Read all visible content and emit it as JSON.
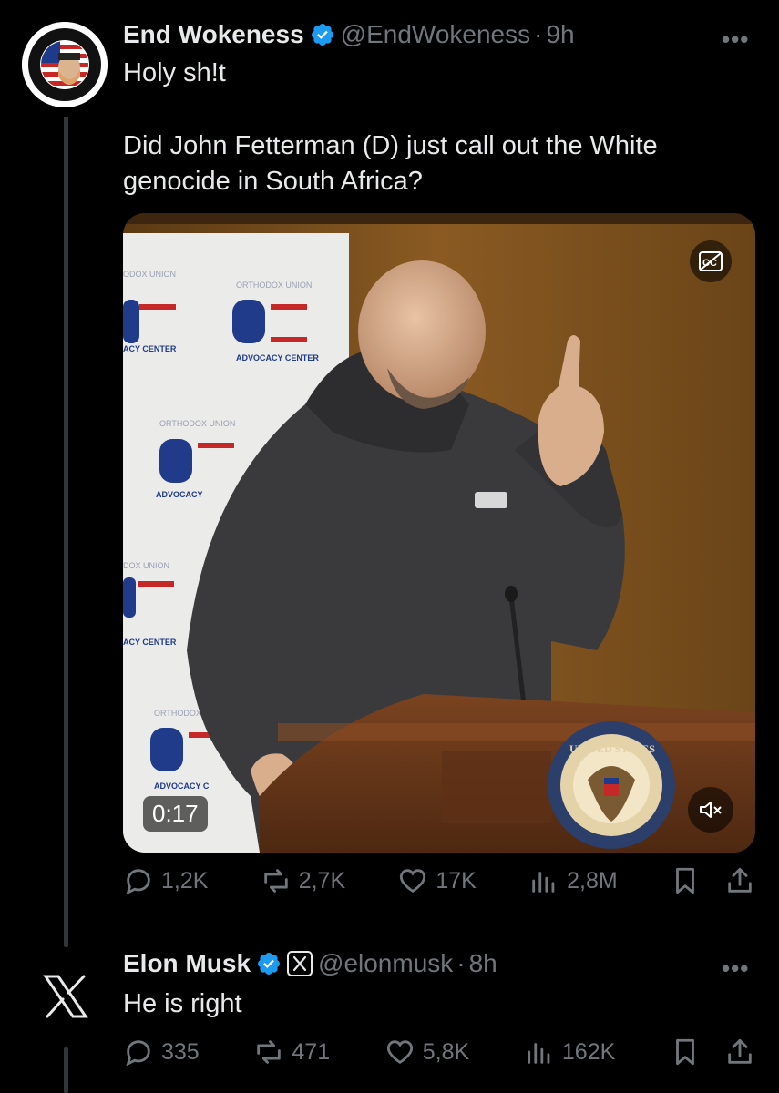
{
  "tweet1": {
    "author": "End Wokeness",
    "handle": "@EndWokeness",
    "separator": "·",
    "time": "9h",
    "more": "•••",
    "text_line1": "Holy sh!t",
    "text_line2": "Did John Fetterman (D) just call out the White",
    "text_line3": "genocide in South Africa?",
    "video": {
      "duration": "0:17",
      "captions_icon": "closed-captions-icon",
      "mute_icon": "speaker-muted-icon",
      "backdrop_org": "ORTHODOX UNION",
      "backdrop_sub": "ADVOCACY CENTER",
      "seal_text": "UNITED STATES"
    },
    "stats": {
      "replies": "1,2K",
      "reposts": "2,7K",
      "likes": "17K",
      "views": "2,8M"
    }
  },
  "tweet2": {
    "author": "Elon Musk",
    "handle": "@elonmusk",
    "separator": "·",
    "time": "8h",
    "more": "•••",
    "text": "He is right",
    "stats": {
      "replies": "335",
      "reposts": "471",
      "likes": "5,8K",
      "views": "162K"
    }
  },
  "colors": {
    "background": "#000000",
    "text": "#e7e9ea",
    "muted": "#71767b",
    "verified_blue": "#1d9bf0",
    "thread_line": "#333639"
  }
}
